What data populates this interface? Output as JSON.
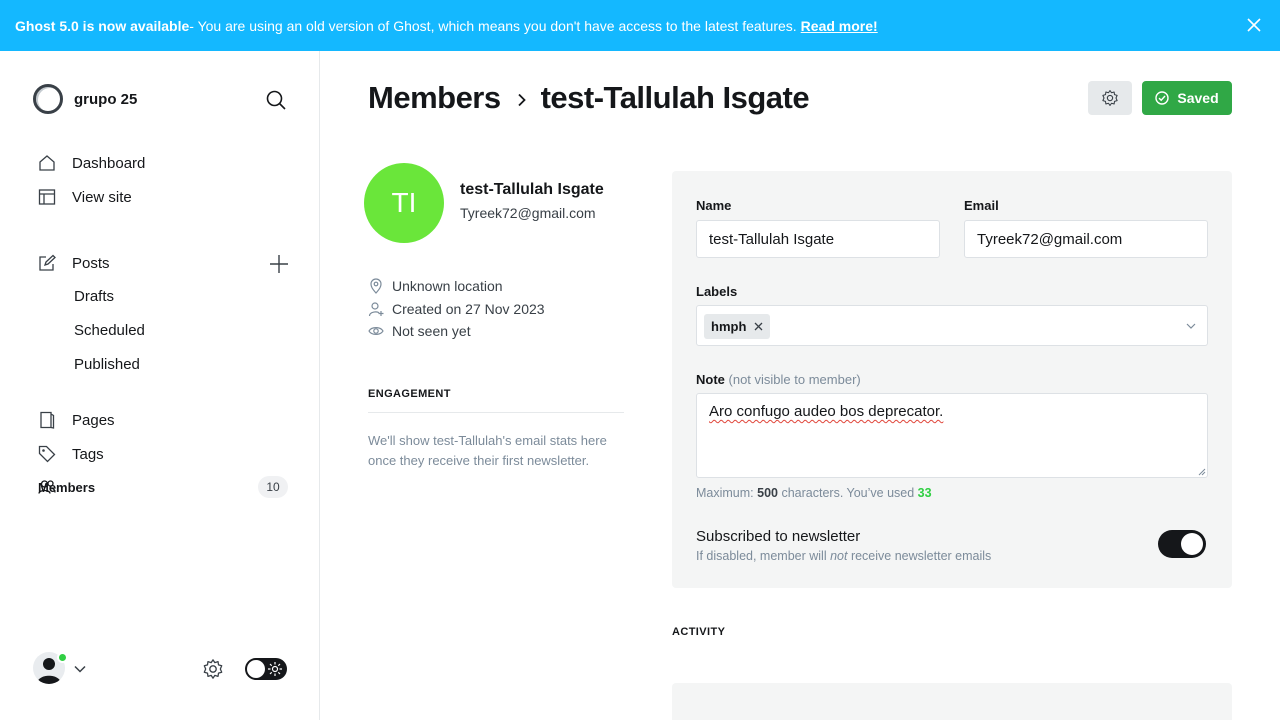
{
  "banner": {
    "bold": "Ghost 5.0 is now available",
    "message": " - You are using an old version of Ghost, which means you don't have access to the latest features.",
    "link": "Read more!"
  },
  "sidebar": {
    "site_name": "grupo 25",
    "items": [
      {
        "label": "Dashboard",
        "icon": "home-icon"
      },
      {
        "label": "View site",
        "icon": "layout-icon"
      },
      {
        "label": "Posts",
        "icon": "edit-icon"
      },
      {
        "label": "Drafts"
      },
      {
        "label": "Scheduled"
      },
      {
        "label": "Published"
      },
      {
        "label": "Pages",
        "icon": "page-icon"
      },
      {
        "label": "Tags",
        "icon": "tag-icon"
      },
      {
        "label": "Members",
        "icon": "members-icon",
        "count": "10"
      }
    ]
  },
  "header": {
    "breadcrumb": "Members",
    "title": "test-Tallulah Isgate",
    "saved_label": "Saved"
  },
  "member": {
    "initials": "TI",
    "name": "test-Tallulah Isgate",
    "email": "Tyreek72@gmail.com",
    "location": "Unknown location",
    "created": "Created on 27 Nov 2023",
    "seen": "Not seen yet",
    "avatar_color": "#6ae63a"
  },
  "engagement": {
    "heading": "ENGAGEMENT",
    "text": "We'll show test-Tallulah's email stats here once they receive their first newsletter."
  },
  "form": {
    "name_label": "Name",
    "name_value": "test-Tallulah Isgate",
    "email_label": "Email",
    "email_value": "Tyreek72@gmail.com",
    "labels_label": "Labels",
    "labels": [
      "hmph"
    ],
    "note_label": "Note",
    "note_hint": "(not visible to member)",
    "note_value": "Aro confugo audeo bos deprecator.",
    "counter_prefix": "Maximum: ",
    "counter_max": "500",
    "counter_mid": " characters. You’ve used ",
    "counter_used": "33",
    "newsletter_title": "Subscribed to newsletter",
    "newsletter_desc_a": "If disabled, member will ",
    "newsletter_desc_em": "not",
    "newsletter_desc_b": " receive newsletter emails",
    "newsletter_enabled": true
  },
  "activity": {
    "heading": "ACTIVITY"
  },
  "colors": {
    "banner": "#14b8ff",
    "saved": "#30a846",
    "accent_green": "#30cf43"
  }
}
